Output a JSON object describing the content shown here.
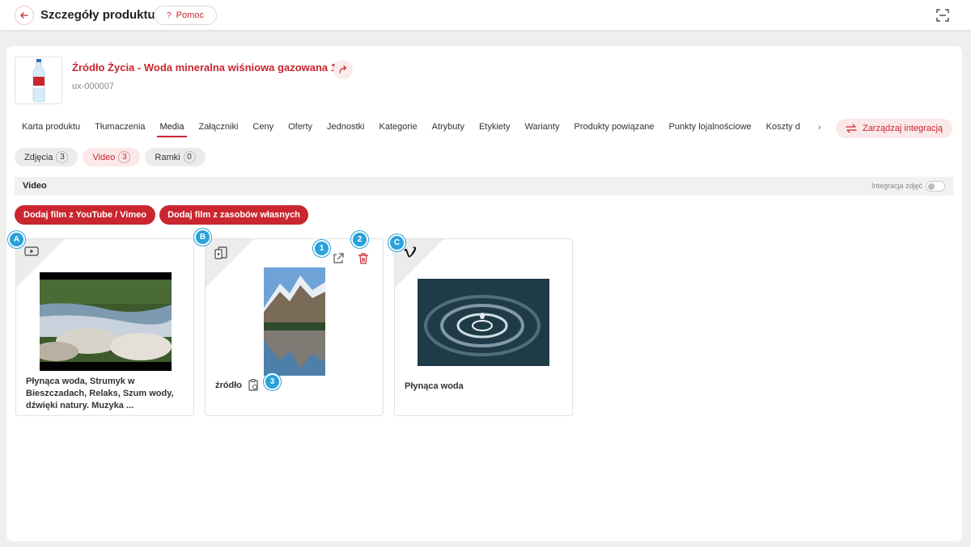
{
  "header": {
    "title": "Szczegóły produktu",
    "help_label": "Pomoc",
    "help_icon": "?"
  },
  "product": {
    "name": "Źródło Życia - Woda mineralna wiśniowa gazowana 1,5l",
    "id": "ux-000007"
  },
  "tabs": [
    {
      "label": "Karta produktu"
    },
    {
      "label": "Tłumaczenia"
    },
    {
      "label": "Media"
    },
    {
      "label": "Załączniki"
    },
    {
      "label": "Ceny"
    },
    {
      "label": "Oferty"
    },
    {
      "label": "Jednostki"
    },
    {
      "label": "Kategorie"
    },
    {
      "label": "Atrybuty"
    },
    {
      "label": "Etykiety"
    },
    {
      "label": "Warianty"
    },
    {
      "label": "Produkty powiązane"
    },
    {
      "label": "Punkty lojalnościowe"
    },
    {
      "label": "Koszty d"
    }
  ],
  "active_tab": "Media",
  "integration_button": "Zarządzaj integracją",
  "media_chips": [
    {
      "label": "Zdjęcia",
      "count": "3"
    },
    {
      "label": "Video",
      "count": "3"
    },
    {
      "label": "Ramki",
      "count": "0"
    }
  ],
  "section": {
    "title": "Video",
    "integration_label": "Integracja zdjęć"
  },
  "buttons": {
    "add_youtube": "Dodaj film z YouTube / Vimeo",
    "add_own": "Dodaj film z zasobów własnych"
  },
  "videos": [
    {
      "title": "Płynąca woda, Strumyk w Bieszczadach, Relaks, Szum wody, dźwięki natury. Muzyka ...",
      "source_icon": "youtube-icon"
    },
    {
      "title": "źródło",
      "source_icon": "file-video-icon"
    },
    {
      "title": "Płynąca woda",
      "source_icon": "vimeo-icon"
    }
  ],
  "markers": {
    "a": "A",
    "b": "B",
    "c": "C",
    "one": "1",
    "two": "2",
    "three": "3"
  },
  "colors": {
    "accent": "#c9262f",
    "marker": "#2aa2d9"
  }
}
